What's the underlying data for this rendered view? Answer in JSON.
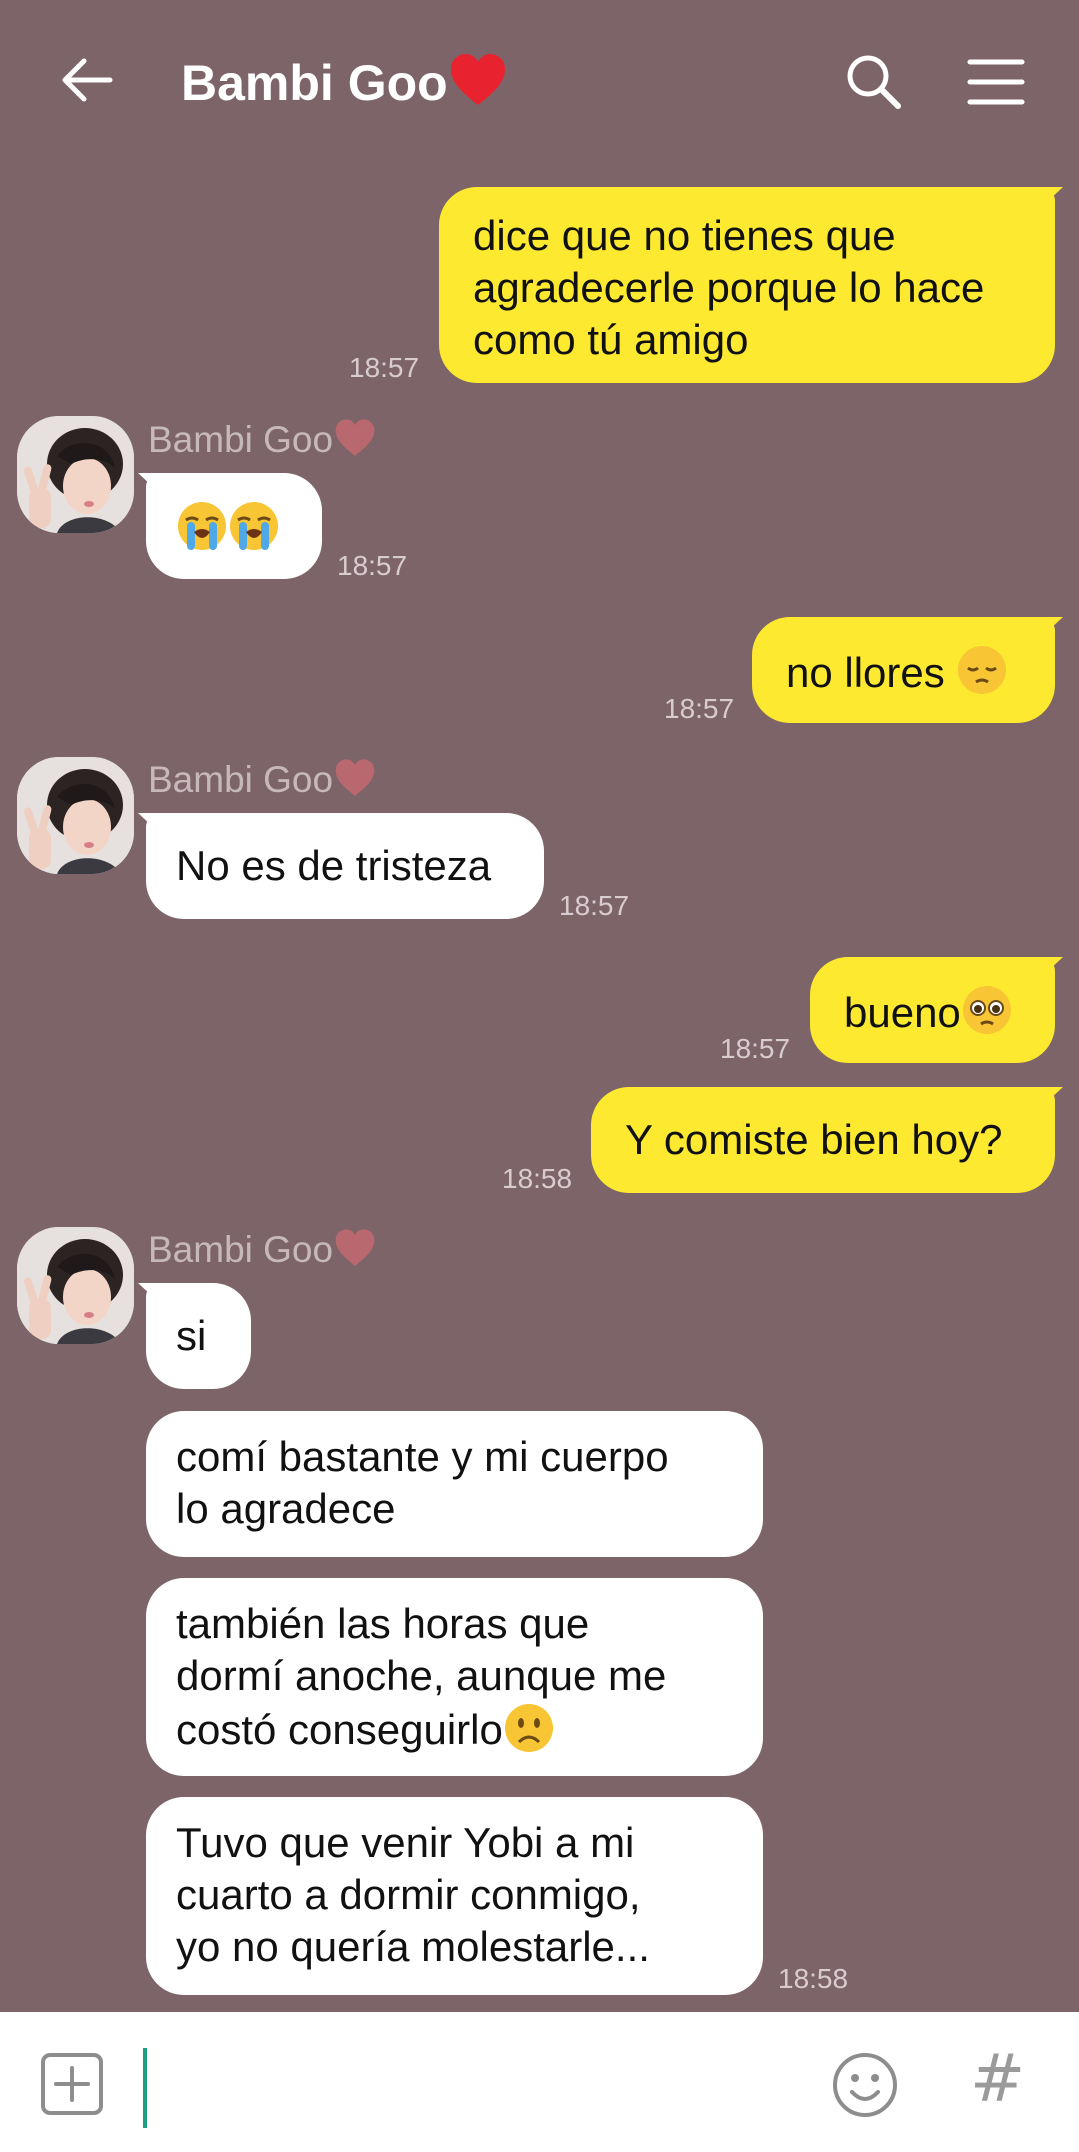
{
  "header": {
    "title": "Bambi Goo",
    "heart": "❤️"
  },
  "sender_name": "Bambi Goo",
  "messages": [
    {
      "dir": "out",
      "text": "dice que no tienes que\nagradecerle porque lo hace\ncomo tú amigo",
      "time": "18:57"
    },
    {
      "dir": "in",
      "text": "",
      "emoji": [
        "loudly-crying-face",
        "loudly-crying-face"
      ],
      "time": "18:57"
    },
    {
      "dir": "out",
      "text": "no llores ",
      "emoji": [
        "pensive-face"
      ],
      "time": "18:57"
    },
    {
      "dir": "in",
      "text": "No es de tristeza",
      "time": "18:57"
    },
    {
      "dir": "out",
      "text": "bueno",
      "emoji": [
        "pleading-face"
      ],
      "time": "18:57"
    },
    {
      "dir": "out",
      "text": "Y comiste bien hoy?",
      "time": "18:58"
    },
    {
      "dir": "in",
      "text": "si"
    },
    {
      "dir": "in",
      "text": "comí bastante y mi cuerpo\nlo agradece"
    },
    {
      "dir": "in",
      "text": "también las horas que\ndormí anoche, aunque me\ncostó conseguirlo",
      "emoji": [
        "frowning-face"
      ]
    },
    {
      "dir": "in",
      "text": "Tuvo que venir Yobi a mi\ncuarto a dormir conmigo,\nyo no quería molestarle...",
      "time": "18:58"
    }
  ],
  "composer": {
    "placeholder": "",
    "hash": "#"
  },
  "colors": {
    "background": "#7c6469",
    "outgoing": "#fde930",
    "incoming": "#ffffff",
    "accent": "#1c9e82"
  }
}
